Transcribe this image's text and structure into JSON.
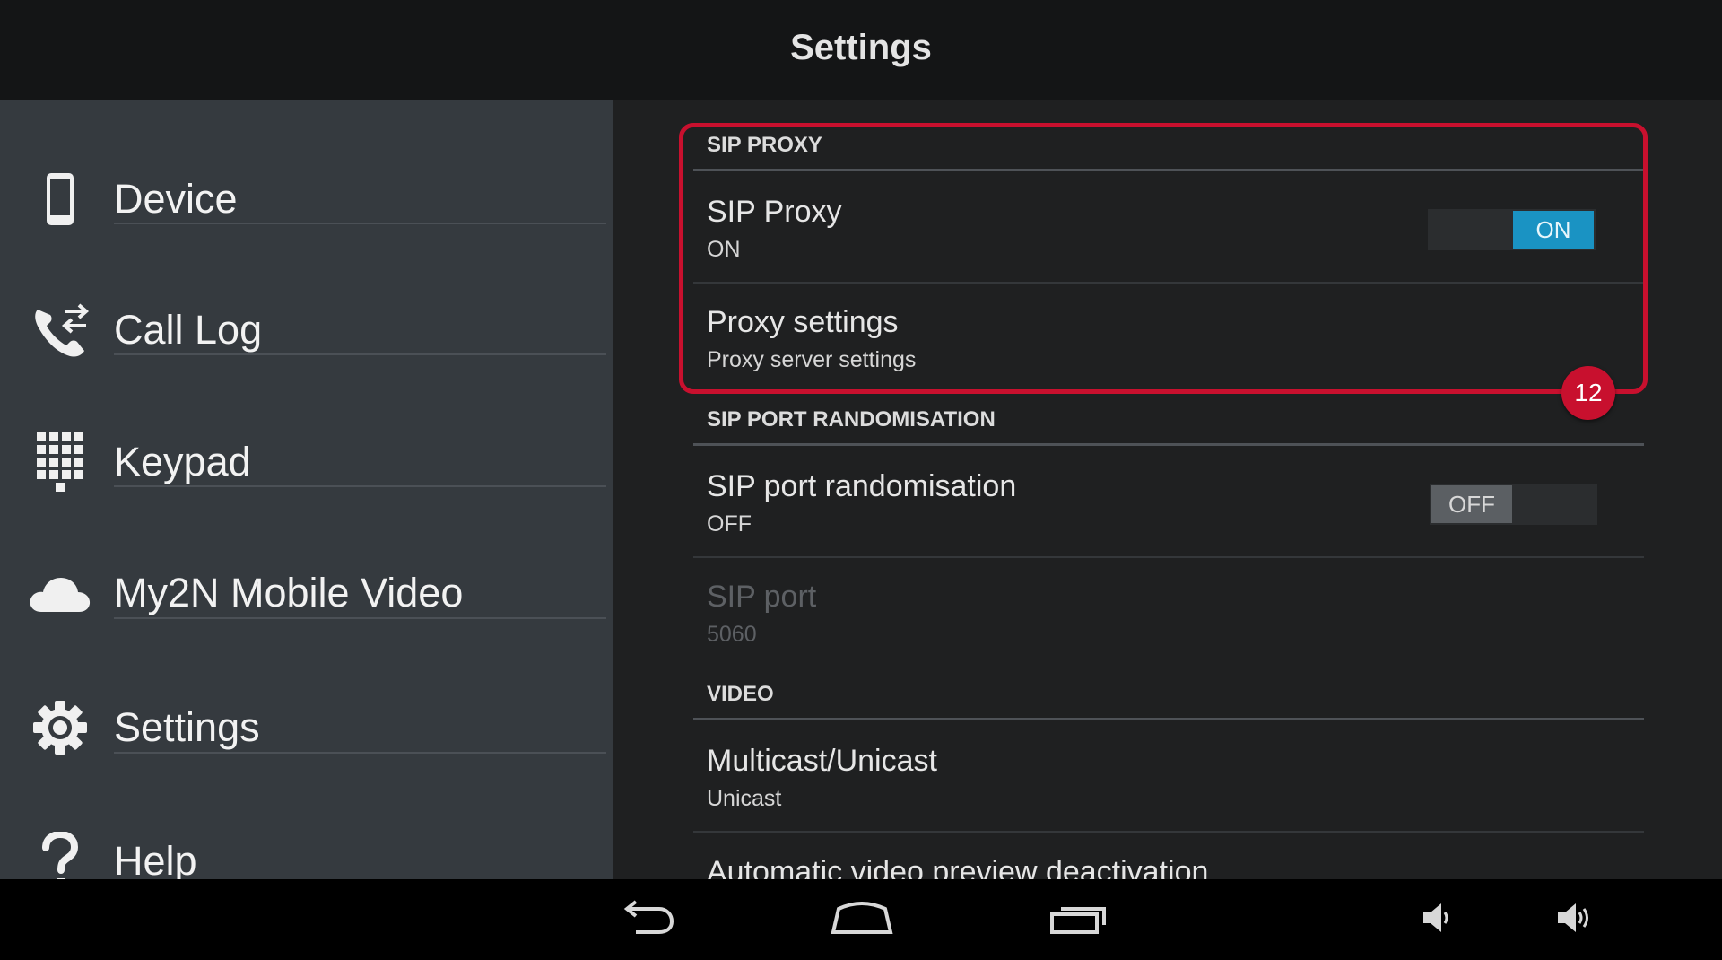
{
  "header": {
    "title": "Settings"
  },
  "sidebar": {
    "items": [
      {
        "label": "Device",
        "icon": "phone-icon"
      },
      {
        "label": "Call Log",
        "icon": "call-log-icon"
      },
      {
        "label": "Keypad",
        "icon": "keypad-icon"
      },
      {
        "label": "My2N Mobile Video",
        "icon": "cloud-icon"
      },
      {
        "label": "Settings",
        "icon": "gear-icon"
      },
      {
        "label": "Help",
        "icon": "help-icon"
      }
    ]
  },
  "sections": {
    "sip_proxy": {
      "header": "SIP PROXY",
      "sip_proxy": {
        "title": "SIP Proxy",
        "summary": "ON",
        "toggle": "ON"
      },
      "proxy_settings": {
        "title": "Proxy settings",
        "summary": "Proxy server settings"
      }
    },
    "sip_port_randomisation": {
      "header": "SIP PORT RANDOMISATION",
      "randomisation": {
        "title": "SIP port randomisation",
        "summary": "OFF",
        "toggle": "OFF"
      },
      "sip_port": {
        "title": "SIP port",
        "summary": "5060"
      }
    },
    "video": {
      "header": "VIDEO",
      "multicast": {
        "title": "Multicast/Unicast",
        "summary": "Unicast"
      },
      "auto_preview": {
        "title": "Automatic video preview deactivation"
      }
    }
  },
  "annotation": {
    "badge": "12",
    "color": "#c8102e"
  },
  "colors": {
    "accent": "#1a93c3",
    "sidebar_bg": "#353a3f",
    "content_bg": "#1f2021"
  },
  "system_nav": {
    "buttons": [
      "back-icon",
      "home-icon",
      "recent-apps-icon",
      "volume-down-icon",
      "volume-up-icon"
    ]
  }
}
